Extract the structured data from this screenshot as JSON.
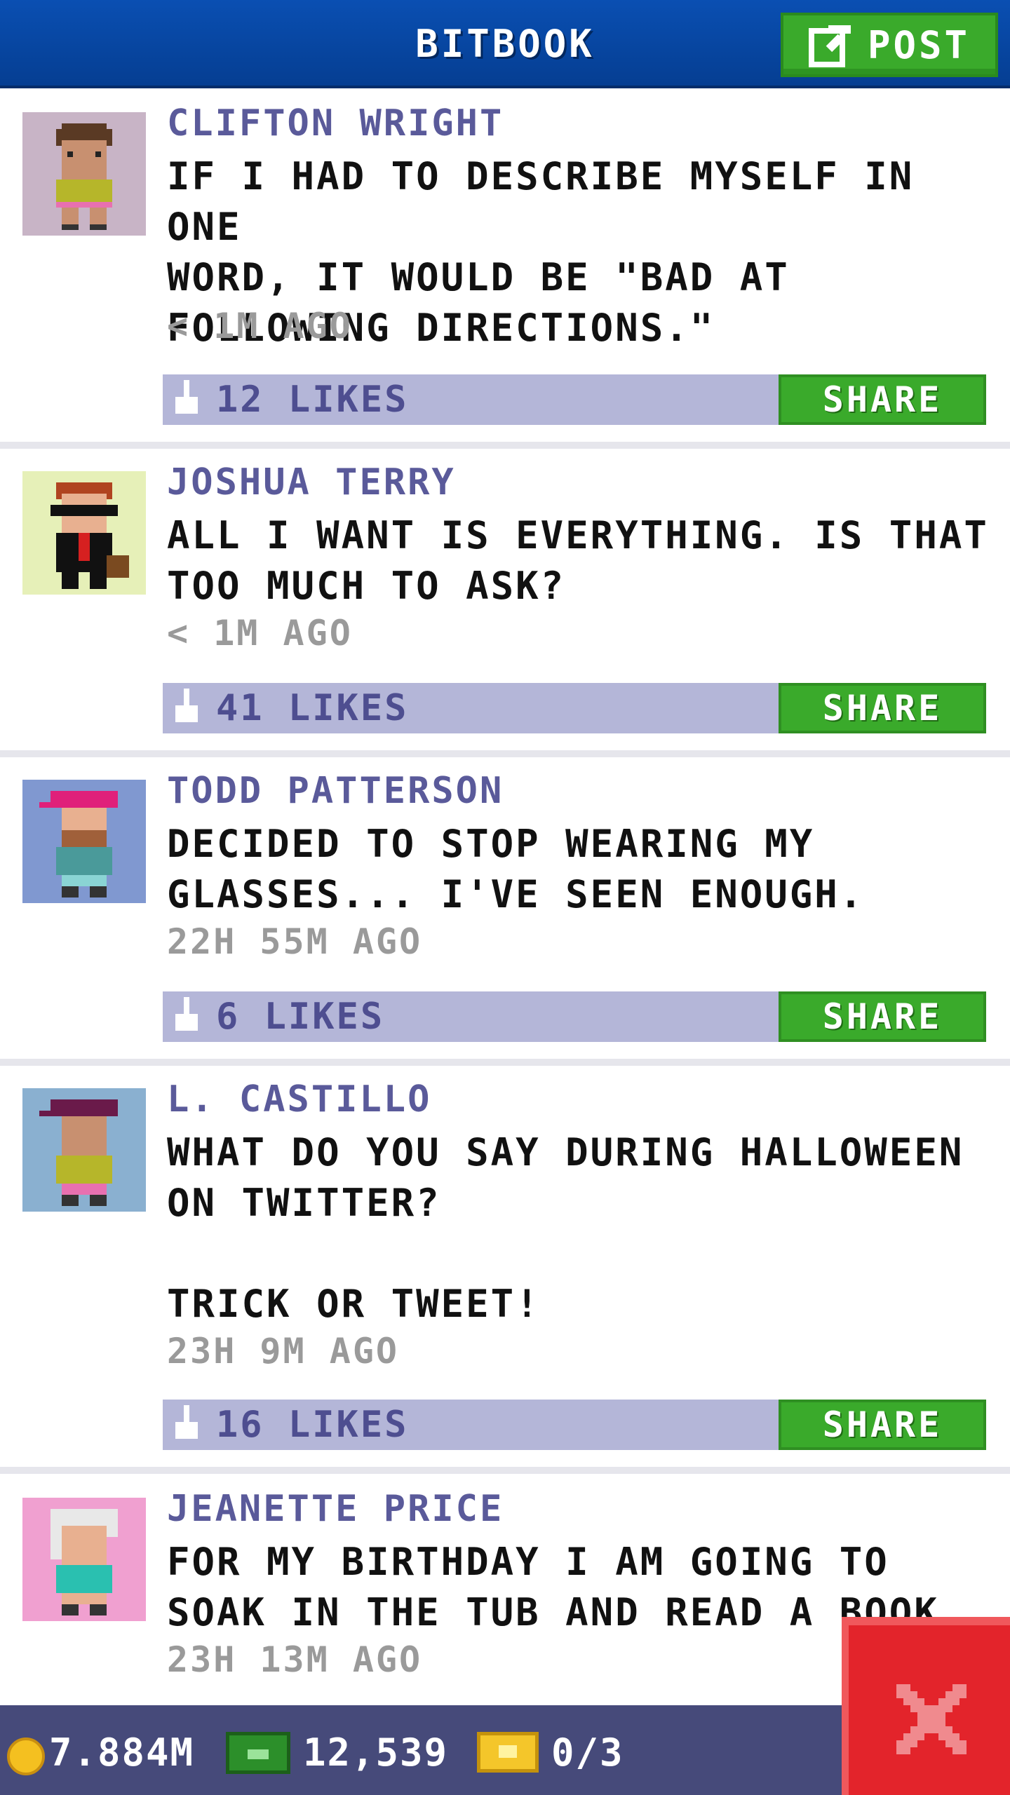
{
  "header": {
    "title": "BITBOOK",
    "post_label": "POST"
  },
  "posts": [
    {
      "author": "CLIFTON WRIGHT",
      "body": "IF I HAD TO DESCRIBE MYSELF IN ONE\nWORD, IT WOULD BE \"BAD AT\nFOLLOWING DIRECTIONS.\"",
      "time": "< 1M AGO",
      "likes": "12 LIKES",
      "share": "SHARE"
    },
    {
      "author": "JOSHUA TERRY",
      "body": "ALL I WANT IS EVERYTHING. IS THAT\nTOO MUCH TO ASK?",
      "time": "< 1M AGO",
      "likes": "41 LIKES",
      "share": "SHARE"
    },
    {
      "author": "TODD PATTERSON",
      "body": "DECIDED TO STOP WEARING MY\nGLASSES... I'VE SEEN ENOUGH.",
      "time": "22H 55M AGO",
      "likes": "6 LIKES",
      "share": "SHARE"
    },
    {
      "author": "L. CASTILLO",
      "body": "WHAT DO YOU SAY DURING HALLOWEEN\nON TWITTER?\n\nTRICK OR TWEET!",
      "time": "23H 9M AGO",
      "likes": "16 LIKES",
      "share": "SHARE"
    },
    {
      "author": "JEANETTE PRICE",
      "body": "FOR MY BIRTHDAY I AM GOING TO\nSOAK IN THE TUB AND READ A BOOK",
      "time": "23H 13M AGO"
    }
  ],
  "footer": {
    "coins": "7.884M",
    "bux": "12,539",
    "tickets": "0/3"
  },
  "colors": {
    "header_blue": "#0a4fb2",
    "button_green": "#3aaa2b",
    "likes_bar": "#b4b6d8",
    "author_purple": "#5a5a9a",
    "close_red": "#e3242b"
  },
  "icons": [
    "edit-icon",
    "thumbs-up-icon",
    "coin-icon",
    "bux-icon",
    "ticket-icon",
    "close-icon"
  ]
}
